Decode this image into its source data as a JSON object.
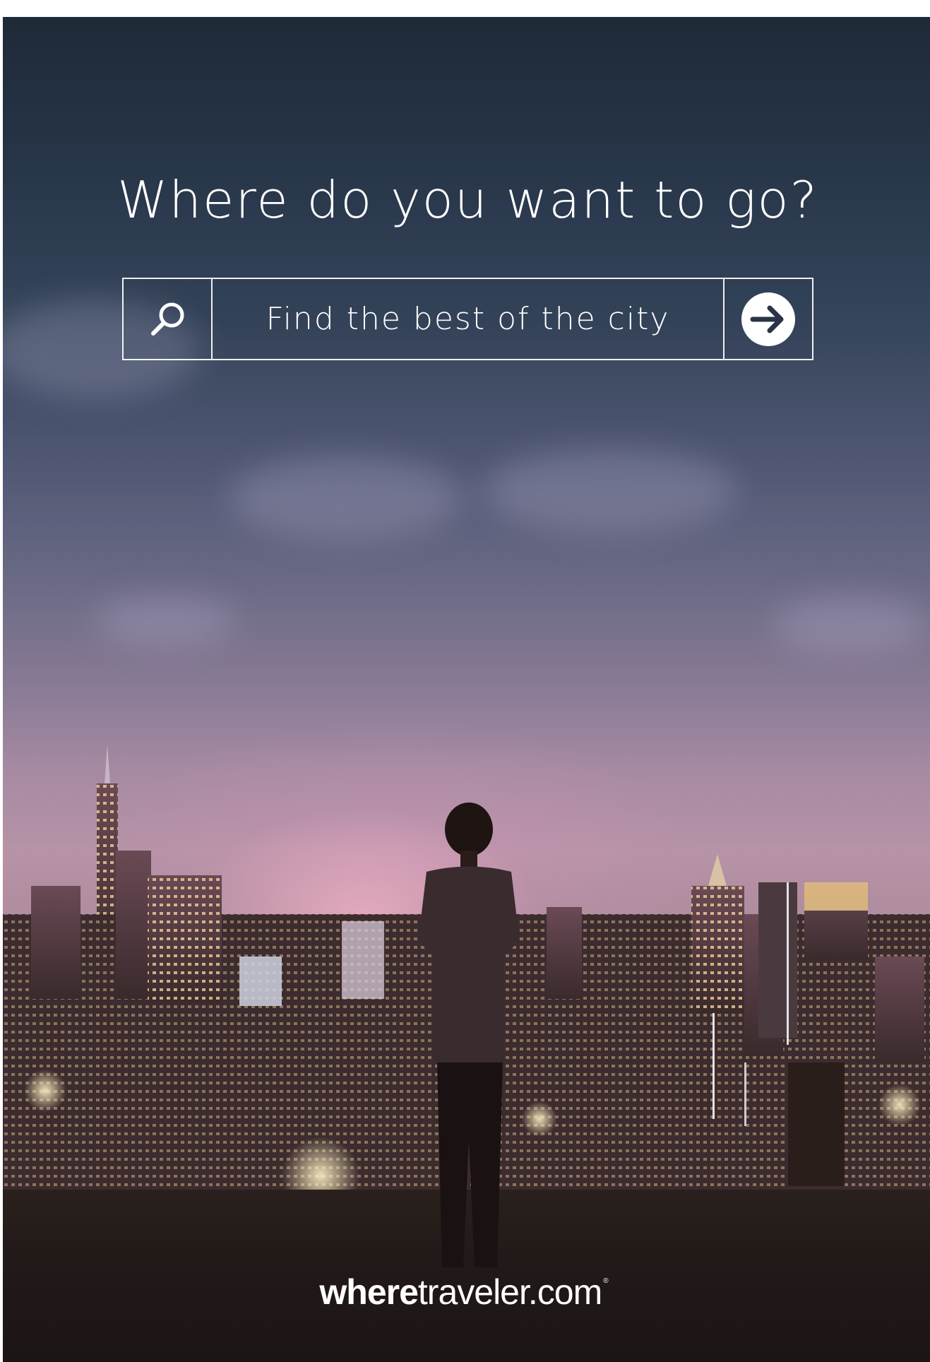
{
  "headline": "Where do you want to go?",
  "search": {
    "icon": "search-icon",
    "text": "Find the best of the city",
    "submit_icon": "arrow-right-circle-icon"
  },
  "logo": {
    "bold": "where",
    "light": "traveler.com",
    "mark": "®"
  },
  "colors": {
    "sky_top": "#1f2a38",
    "sky_mid": "#6a6a86",
    "haze": "#b693a6",
    "ground": "#221a18",
    "text": "#ffffff"
  }
}
